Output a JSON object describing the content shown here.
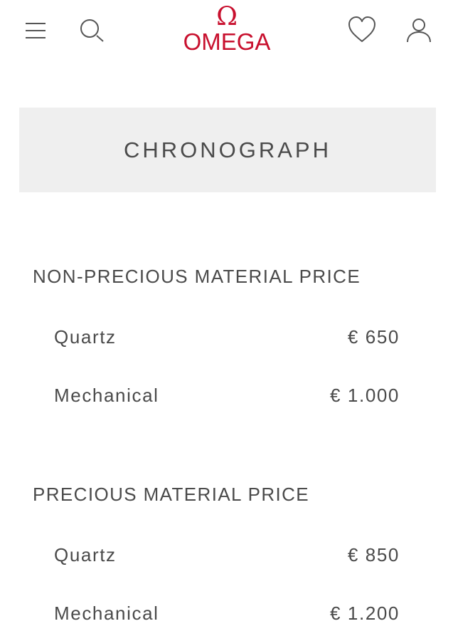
{
  "header": {
    "logo_symbol": "Ω",
    "logo_word": "OMEGA"
  },
  "banner": {
    "title": "CHRONOGRAPH"
  },
  "sections": [
    {
      "title": "NON-PRECIOUS MATERIAL PRICE",
      "rows": [
        {
          "label": "Quartz",
          "price": "€ 650"
        },
        {
          "label": "Mechanical",
          "price": "€ 1.000"
        }
      ]
    },
    {
      "title": "PRECIOUS MATERIAL PRICE",
      "rows": [
        {
          "label": "Quartz",
          "price": "€ 850"
        },
        {
          "label": "Mechanical",
          "price": "€ 1.200"
        }
      ]
    }
  ],
  "colors": {
    "brand": "#c8102e",
    "text": "#4a4a4a",
    "banner_bg": "#efefef"
  },
  "icons": [
    "menu-icon",
    "search-icon",
    "heart-icon",
    "user-icon"
  ]
}
